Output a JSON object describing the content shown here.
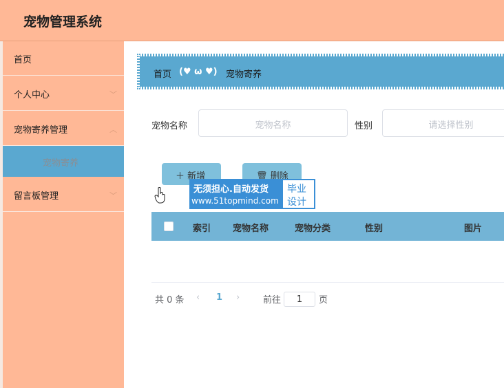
{
  "header": {
    "title": "宠物管理系统"
  },
  "sidebar": {
    "items": [
      {
        "label": "首页"
      },
      {
        "label": "个人中心"
      },
      {
        "label": "宠物寄养管理"
      },
      {
        "label": "留言板管理"
      }
    ],
    "active_sub": {
      "label": "宠物寄养"
    }
  },
  "breadcrumb": {
    "home": "首页",
    "separator": "(♥ ω ♥)",
    "current": "宠物寄养"
  },
  "filters": {
    "name_label": "宠物名称",
    "name_placeholder": "宠物名称",
    "gender_label": "性别",
    "gender_placeholder": "请选择性别"
  },
  "actions": {
    "add": "新增",
    "delete": "删除"
  },
  "watermark": {
    "line1": "无须担心.自动发货",
    "line2": "www.51topmind.com",
    "right_top": "毕业",
    "right_bottom": "设计"
  },
  "table": {
    "headers": [
      "索引",
      "宠物名称",
      "宠物分类",
      "性别",
      "图片"
    ]
  },
  "pagination": {
    "total": "共 0 条",
    "current_page": "1",
    "goto": "前往",
    "page_input": "1",
    "page_unit": "页"
  },
  "colors": {
    "header": "#ffb896",
    "accent": "#5aa8d0",
    "table_header": "#73b4d6"
  }
}
